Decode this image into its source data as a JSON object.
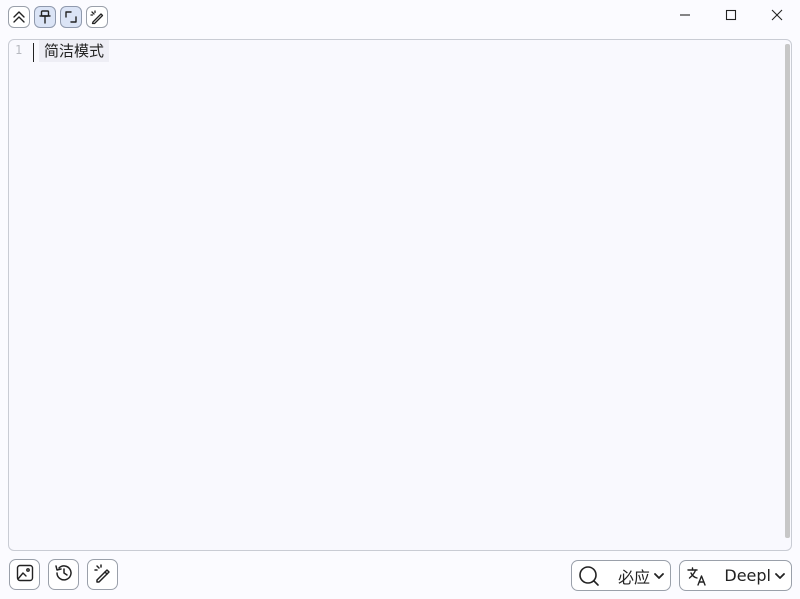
{
  "top_toolbar": {
    "buttons": [
      {
        "icon": "collapse-up-icon",
        "active": false
      },
      {
        "icon": "pin-icon",
        "active": true
      },
      {
        "icon": "corner-frame-icon",
        "active": true
      },
      {
        "icon": "magic-pen-icon",
        "active": false
      }
    ]
  },
  "window_controls": {
    "minimize_icon": "minimize-icon",
    "maximize_icon": "maximize-icon",
    "close_icon": "close-icon"
  },
  "editor": {
    "line_number": "1",
    "text": "简洁模式"
  },
  "bottom_toolbar": {
    "buttons": [
      {
        "icon": "image-icon"
      },
      {
        "icon": "history-icon"
      },
      {
        "icon": "pen-icon"
      }
    ]
  },
  "search_engine": {
    "icon": "search-icon",
    "selected": "必应"
  },
  "translator": {
    "icon": "translate-icon",
    "selected": "Deepl"
  },
  "colors": {
    "background": "#fbfbff",
    "border": "#9aa0aa",
    "active_button": "#dbe4f6",
    "line_highlight": "#eeeef5"
  }
}
